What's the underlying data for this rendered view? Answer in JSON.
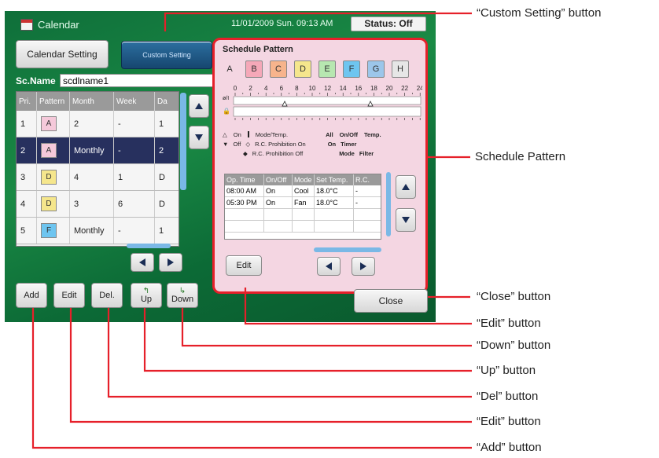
{
  "window": {
    "title": "Calendar",
    "datetime": "11/01/2009 Sun. 09:13 AM",
    "status": "Status: Off"
  },
  "top_buttons": {
    "calendar_setting": "Calendar Setting",
    "custom_setting": "Custom Setting"
  },
  "scname": {
    "label": "Sc.Name",
    "value": "scdlname1"
  },
  "table": {
    "headers": [
      "Pri.",
      "Pattern",
      "Month",
      "Week",
      "Da"
    ],
    "rows": [
      {
        "pri": "1",
        "pattern": "A",
        "month": "2",
        "week": "-",
        "day": "1"
      },
      {
        "pri": "2",
        "pattern": "A",
        "month": "Monthly",
        "week": "-",
        "day": "2"
      },
      {
        "pri": "3",
        "pattern": "D",
        "month": "4",
        "week": "1",
        "day": "D"
      },
      {
        "pri": "4",
        "pattern": "D",
        "month": "3",
        "week": "6",
        "day": "D"
      },
      {
        "pri": "5",
        "pattern": "F",
        "month": "Monthly",
        "week": "-",
        "day": "1"
      }
    ],
    "selected_row": 2
  },
  "bottom_buttons": {
    "add": "Add",
    "edit": "Edit",
    "del": "Del.",
    "up": "Up",
    "down": "Down"
  },
  "schedule_pattern": {
    "title": "Schedule Pattern",
    "tabs": [
      {
        "label": "A",
        "color": "#f4d6e2"
      },
      {
        "label": "B",
        "color": "#f5a8b8"
      },
      {
        "label": "C",
        "color": "#f7b48c"
      },
      {
        "label": "D",
        "color": "#f5e68c"
      },
      {
        "label": "E",
        "color": "#b7e7b0"
      },
      {
        "label": "F",
        "color": "#6ec5f0"
      },
      {
        "label": "G",
        "color": "#9cc6ea"
      },
      {
        "label": "H",
        "color": "#e6e6e6"
      }
    ],
    "hours": [
      "0",
      "2",
      "4",
      "6",
      "8",
      "10",
      "12",
      "14",
      "16",
      "18",
      "20",
      "22",
      "24"
    ],
    "row_labels": {
      "onoff": "ø/I",
      "lock": "🔒"
    },
    "legend": {
      "on": "On",
      "mode_temp": "Mode/Temp.",
      "off": "Off",
      "rc_prohib_on": "R.C. Prohibition On",
      "rc_prohib_off": "R.C. Prohibition Off",
      "all": "All",
      "onoff": "On/Off",
      "temp": "Temp.",
      "on2": "On",
      "timer": "Timer",
      "mode": "Mode",
      "filter": "Filter"
    },
    "op_table": {
      "headers": [
        "Op. Time",
        "On/Off",
        "Mode",
        "Set Temp.",
        "R.C."
      ],
      "rows": [
        {
          "time": "08:00 AM",
          "onoff": "On",
          "mode": "Cool",
          "temp": "18.0°C",
          "rc": "-"
        },
        {
          "time": "05:30 PM",
          "onoff": "On",
          "mode": "Fan",
          "temp": "18.0°C",
          "rc": "-"
        }
      ]
    },
    "edit_label": "Edit"
  },
  "close_label": "Close",
  "callouts": {
    "custom_setting": "“Custom Setting” button",
    "schedule_pattern": "Schedule Pattern",
    "close": "“Close” button",
    "edit_right": "“Edit” button",
    "down": "“Down” button",
    "up": "“Up” button",
    "del": "“Del” button",
    "edit_left": "“Edit” button",
    "add": "“Add” button"
  },
  "colors": {
    "highlight": "#e6202a",
    "selected_row": "#27305e",
    "scroll_accent": "#7ab8e6"
  }
}
